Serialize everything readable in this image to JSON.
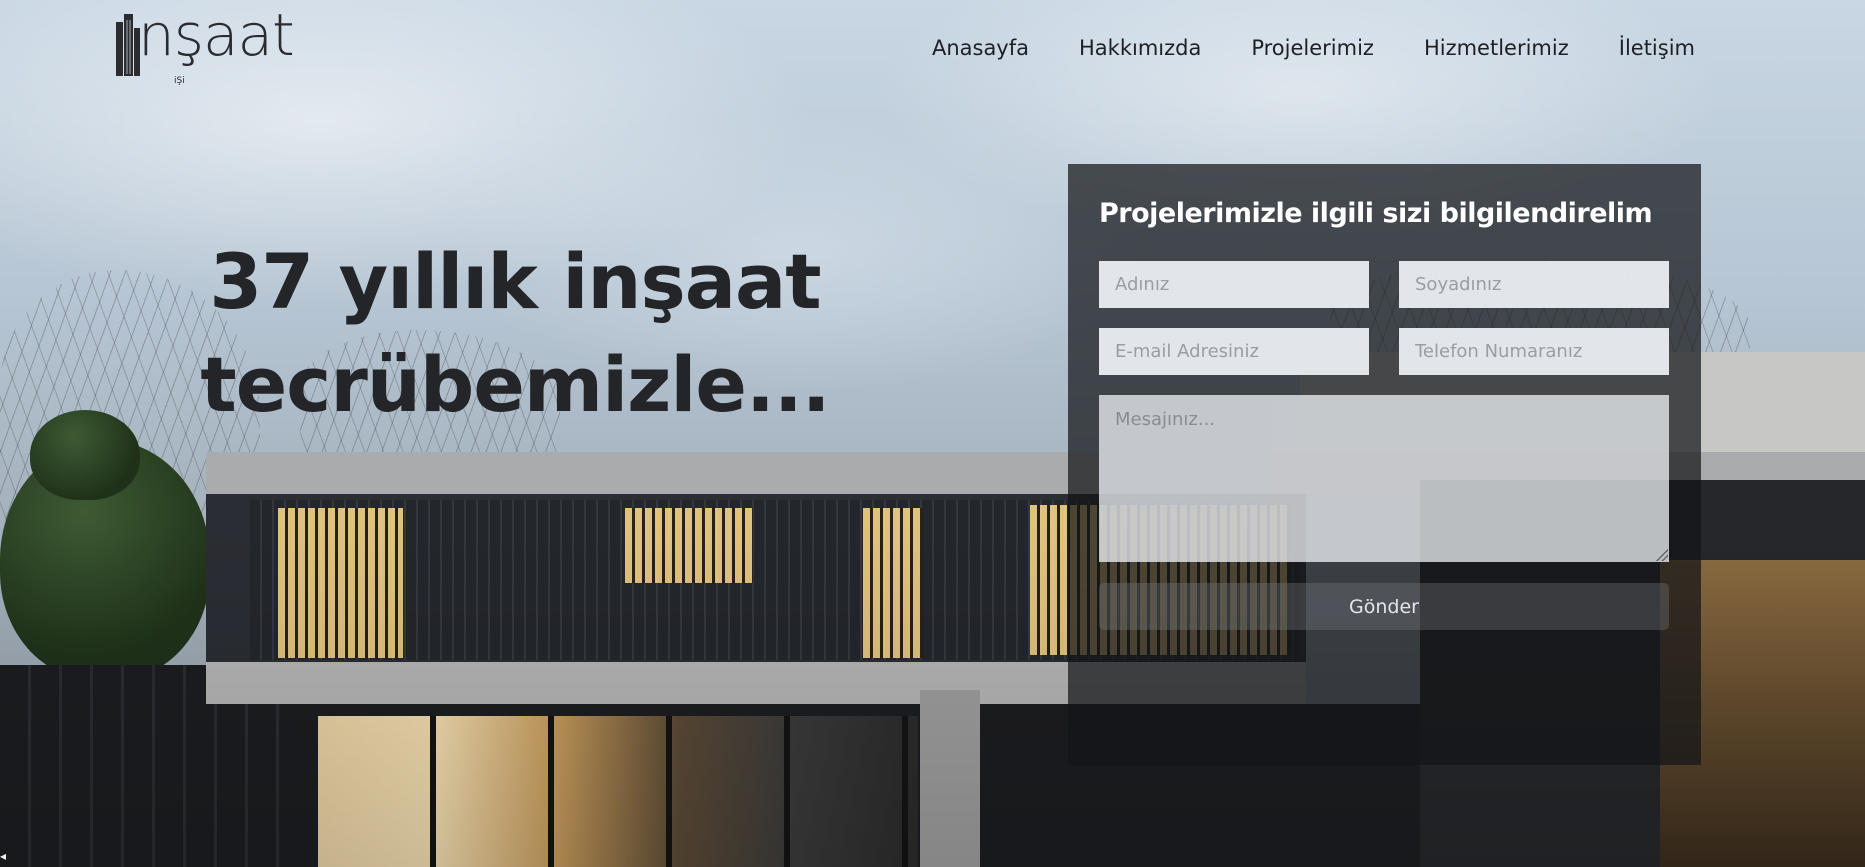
{
  "brand": {
    "logo_text": "nşaat",
    "logo_sub": "iŞi"
  },
  "nav": {
    "items": [
      {
        "label": "Anasayfa"
      },
      {
        "label": "Hakkımızda"
      },
      {
        "label": "Projelerimiz"
      },
      {
        "label": "Hizmetlerimiz"
      },
      {
        "label": "İletişim"
      }
    ]
  },
  "hero": {
    "headline_line1": "37 yıllık inşaat",
    "headline_line2": "tecrübemizle..."
  },
  "contact_form": {
    "title": "Projelerimizle ilgili sizi bilgilendirelim",
    "name_placeholder": "Adınız",
    "surname_placeholder": "Soyadınız",
    "email_placeholder": "E-mail Adresiniz",
    "phone_placeholder": "Telefon Numaranız",
    "message_placeholder": "Mesajınız...",
    "submit_label": "Gönder"
  },
  "colors": {
    "text_dark": "#242528",
    "panel_bg": "#141518",
    "panel_title": "#ffffff"
  }
}
